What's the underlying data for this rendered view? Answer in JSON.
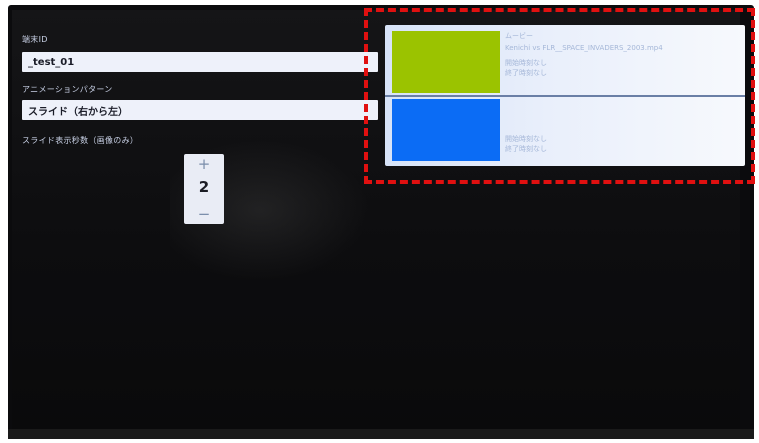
{
  "settings": {
    "name_label": "端末ID",
    "name_value": "_test_01",
    "animation_label": "アニメーションパターン",
    "animation_value": "スライド（右から左）",
    "slide_seconds_label": "スライド表示秒数（画像のみ）",
    "stepper": {
      "plus": "+",
      "value": "2",
      "minus": "−"
    }
  },
  "playlist": {
    "items": [
      {
        "thumb_color": "#9bc300",
        "title": "ムービー",
        "filename": "Kenichi vs FLR__SPACE_INVADERS_2003.mp4",
        "line1": "開始時刻なし",
        "line2": "終了時刻なし"
      },
      {
        "thumb_color": "#0b6cf5",
        "title": "",
        "filename": "",
        "line1": "開始時刻なし",
        "line2": "終了時刻なし"
      }
    ]
  },
  "annotation": {
    "color": "#e01010",
    "style": "dashed"
  }
}
